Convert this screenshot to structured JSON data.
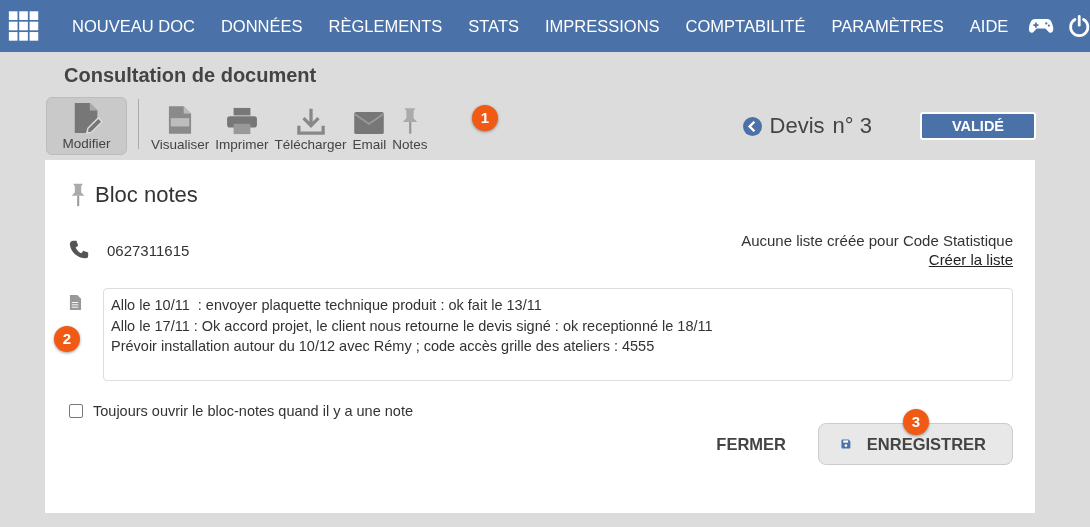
{
  "nav": {
    "items": [
      "NOUVEAU DOC",
      "DONNÉES",
      "RÈGLEMENTS",
      "STATS",
      "IMPRESSIONS",
      "COMPTABILITÉ",
      "PARAMÈTRES",
      "AIDE"
    ]
  },
  "page_title": "Consultation de document",
  "toolbar": [
    {
      "kind": "edit",
      "label": "Modifier",
      "selected": true
    },
    {
      "kind": "pdf",
      "label": "Visualiser",
      "selected": false
    },
    {
      "kind": "print",
      "label": "Imprimer",
      "selected": false
    },
    {
      "kind": "download",
      "label": "Télécharger",
      "selected": false
    },
    {
      "kind": "email",
      "label": "Email",
      "selected": false
    },
    {
      "kind": "pin",
      "label": "Notes",
      "selected": false
    }
  ],
  "document": {
    "type": "Devis",
    "number": "n° 3",
    "status": "VALIDÉ"
  },
  "notes_panel": {
    "title": "Bloc notes",
    "phone": "0627311615",
    "stat_info": "Aucune liste créée pour Code Statistique",
    "stat_link": "Créer la liste",
    "notes": [
      "Allo le 10/11  : envoyer plaquette technique produit : ok fait le 13/11",
      "Allo le 17/11 : Ok accord projet, le client nous retourne le devis signé : ok receptionné le 18/11",
      "Prévoir installation autour du 10/12 avec Rémy ; code accès grille des ateliers : 4555"
    ],
    "always_open": {
      "label": "Toujours ouvrir le bloc-notes quand il y a une note",
      "checked": false
    },
    "buttons": [
      {
        "kind": "text",
        "label": "FERMER"
      },
      {
        "kind": "save",
        "label": "ENREGISTRER"
      }
    ]
  },
  "callouts": [
    "1",
    "2",
    "3"
  ]
}
